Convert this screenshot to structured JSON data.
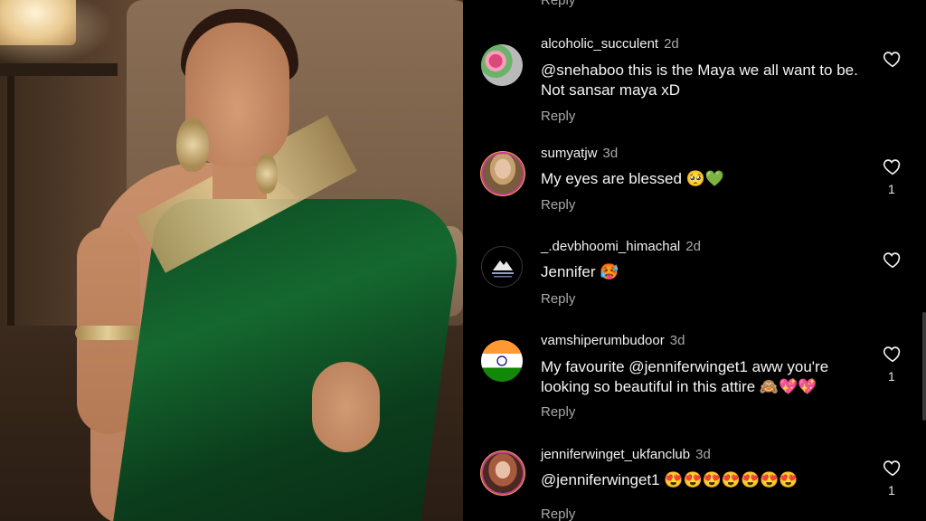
{
  "photo": {
    "alt_icon": "saree-portrait-photo"
  },
  "top_reply": "Reply",
  "comments": [
    {
      "username": "alcoholic_succulent",
      "time": "2d",
      "text": "@snehaboo this is the Maya we all want to be. Not sansar maya xD",
      "reply": "Reply",
      "likes": ""
    },
    {
      "username": "sumyatjw",
      "time": "3d",
      "text": "My eyes are blessed 🥺💚",
      "reply": "Reply",
      "likes": "1"
    },
    {
      "username": "_.devbhoomi_himachal",
      "time": "2d",
      "text": "Jennifer 🥵",
      "reply": "Reply",
      "likes": ""
    },
    {
      "username": "vamshiperumbudoor",
      "time": "3d",
      "text": "My favourite @jenniferwinget1 aww you're looking so beautiful in this attire 🙈💖💖",
      "reply": "Reply",
      "likes": "1"
    },
    {
      "username": "jenniferwinget_ukfanclub",
      "time": "3d",
      "text": "@jenniferwinget1 😍😍😍😍😍😍😍",
      "reply": "Reply",
      "likes": "1"
    }
  ],
  "colors": {
    "muted": "#a8a8a8",
    "text": "#f5f5f5",
    "background": "#000000"
  }
}
